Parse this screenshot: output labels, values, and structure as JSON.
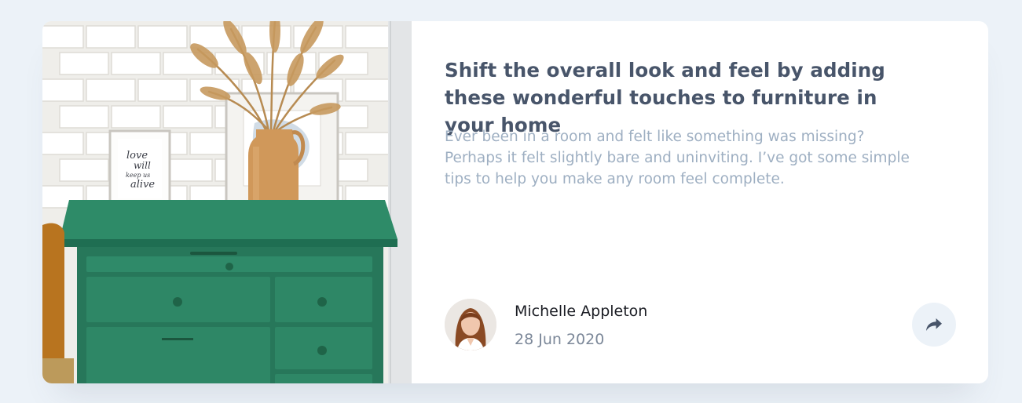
{
  "article": {
    "title": "Shift the overall look and feel by adding these wonderful touches to furniture in your home",
    "description": "Ever been in a room and felt like something was missing? Perhaps it felt slightly bare and uninviting. I’ve got some simple tips to help you make any room feel complete.",
    "image_alt": "Green drawer cabinet with a vase of dried grass and framed prints"
  },
  "author": {
    "name": "Michelle Appleton",
    "date": "28 Jun 2020"
  },
  "print_text": [
    "love",
    "will",
    "keep us",
    "alive"
  ],
  "icons": {
    "share": "share-icon"
  },
  "colors": {
    "page_bg": "#ecf2f8",
    "title": "#48556a",
    "description": "#9eafc2",
    "date": "#9eafc2",
    "share_bg": "#ecf2f8",
    "share_icon": "#6e8098"
  }
}
